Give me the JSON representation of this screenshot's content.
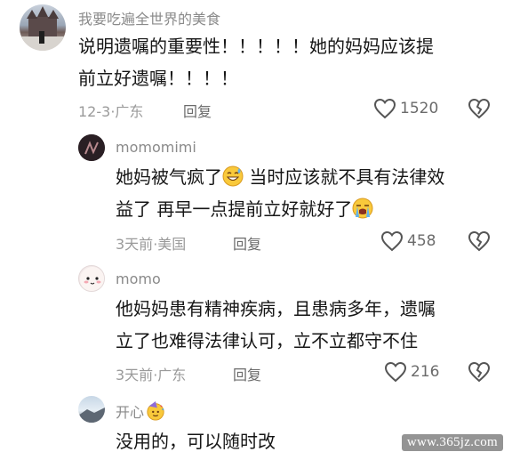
{
  "comments": [
    {
      "username": "我要吃遍全世界的美食",
      "lines": [
        "说明遗嘱的重要性！！！！！她的妈妈应该提",
        "前立好遗嘱！！！！"
      ],
      "date": "12-3",
      "location": "广东",
      "reply_label": "回复",
      "likes": "1520"
    },
    {
      "username": "momomimi",
      "line1_a": "她妈被气疯了",
      "line1_b": " 当时应该就不具有法律效",
      "line2_a": "益了 再早一点提前立好就好了",
      "date": "3天前",
      "location": "美国",
      "reply_label": "回复",
      "likes": "458"
    },
    {
      "username": "momo",
      "lines": [
        "他妈妈患有精神疾病，且患病多年，遗嘱",
        "立了也难得法律认可，立不立都守不住"
      ],
      "date": "3天前",
      "location": "广东",
      "reply_label": "回复",
      "likes": "216"
    },
    {
      "username": "开心",
      "lines": [
        "没用的，可以随时改"
      ]
    }
  ],
  "watermark": "www.365jz.com",
  "icons": {
    "like": "heart-outline-icon",
    "dislike": "broken-heart-icon",
    "emoji_sweat": "grinning-sweat-emoji",
    "emoji_cry": "loudly-crying-emoji",
    "emoji_party": "party-face-emoji"
  }
}
